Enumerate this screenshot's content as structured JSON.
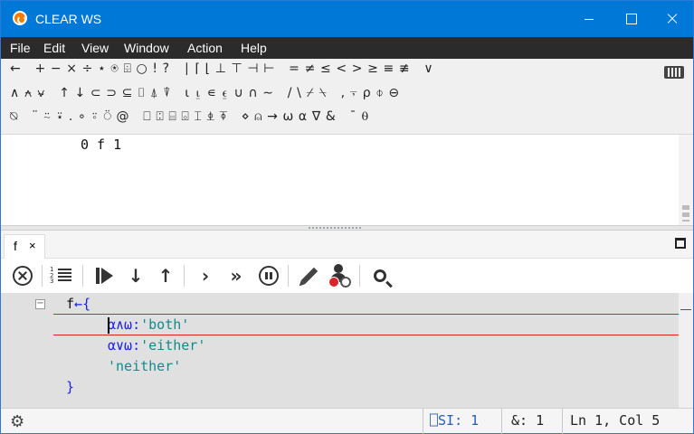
{
  "window": {
    "title": "CLEAR WS"
  },
  "menubar": {
    "items": [
      "File",
      "Edit",
      "View",
      "Window",
      "Action",
      "Help"
    ]
  },
  "language_bar": {
    "row1": "←   + − × ÷ ⋆ ⍟ ⌹ ○ ! ?   ∣ ⌈ ⌊ ⊥ ⊤ ⊣ ⊢   = ≠ ≤ < > ≥ ≡ ≢   ∨",
    "row2": "∧ ⍲ ⍱   ↑ ↓ ⊂ ⊃ ⊆ ⌷ ⍋ ⍒   ⍳ ⍸ ∊ ⍷ ∪ ∩ ∼   / \\ ⌿ ⍀   , ⍪ ⍴ ⌽ ⊖",
    "row3": "⍉   ¨ ⍨ ⍣ . ∘ ⍤ ⍥ @   ⎕ ⍠ ⌸ ⌺ ⌶ ⍎ ⍕   ⋄ ⍝ → ⍵ ⍺ ∇ &   ¯ ⍬",
    "keyboard_icon": "keyboard-icon"
  },
  "session": {
    "line1": "0 f 1"
  },
  "editor_tab": {
    "label": "f",
    "close": "×"
  },
  "editor_toolbar": {
    "icons": [
      "close-circle-icon",
      "line-numbers-icon",
      "run-icon",
      "step-into-icon",
      "step-out-icon",
      "skip-icon",
      "fast-forward-icon",
      "pause-icon",
      "edit-icon",
      "clear-stops-icon",
      "search-icon"
    ]
  },
  "editor": {
    "fold_marker": "⊟",
    "line1": {
      "name": "f",
      "arrow": "←",
      "brace": "{"
    },
    "line2": {
      "guard": "⍺∧⍵:",
      "string": "'both'"
    },
    "line3": {
      "guard": "⍺∨⍵:",
      "string": "'either'"
    },
    "line4": {
      "string": "'neither'"
    },
    "line5": {
      "brace": "}"
    }
  },
  "statusbar": {
    "si": "⎕SI: 1",
    "amp": "&: 1",
    "position": "Ln 1, Col 5"
  },
  "colors": {
    "titlebar": "#0078d7",
    "menubar": "#2b2b2b",
    "editor_bg": "#e0e0e0",
    "keyword_blue": "#1b22e6",
    "string_teal": "#138a8a",
    "stop_line_red": "#dd2222"
  }
}
